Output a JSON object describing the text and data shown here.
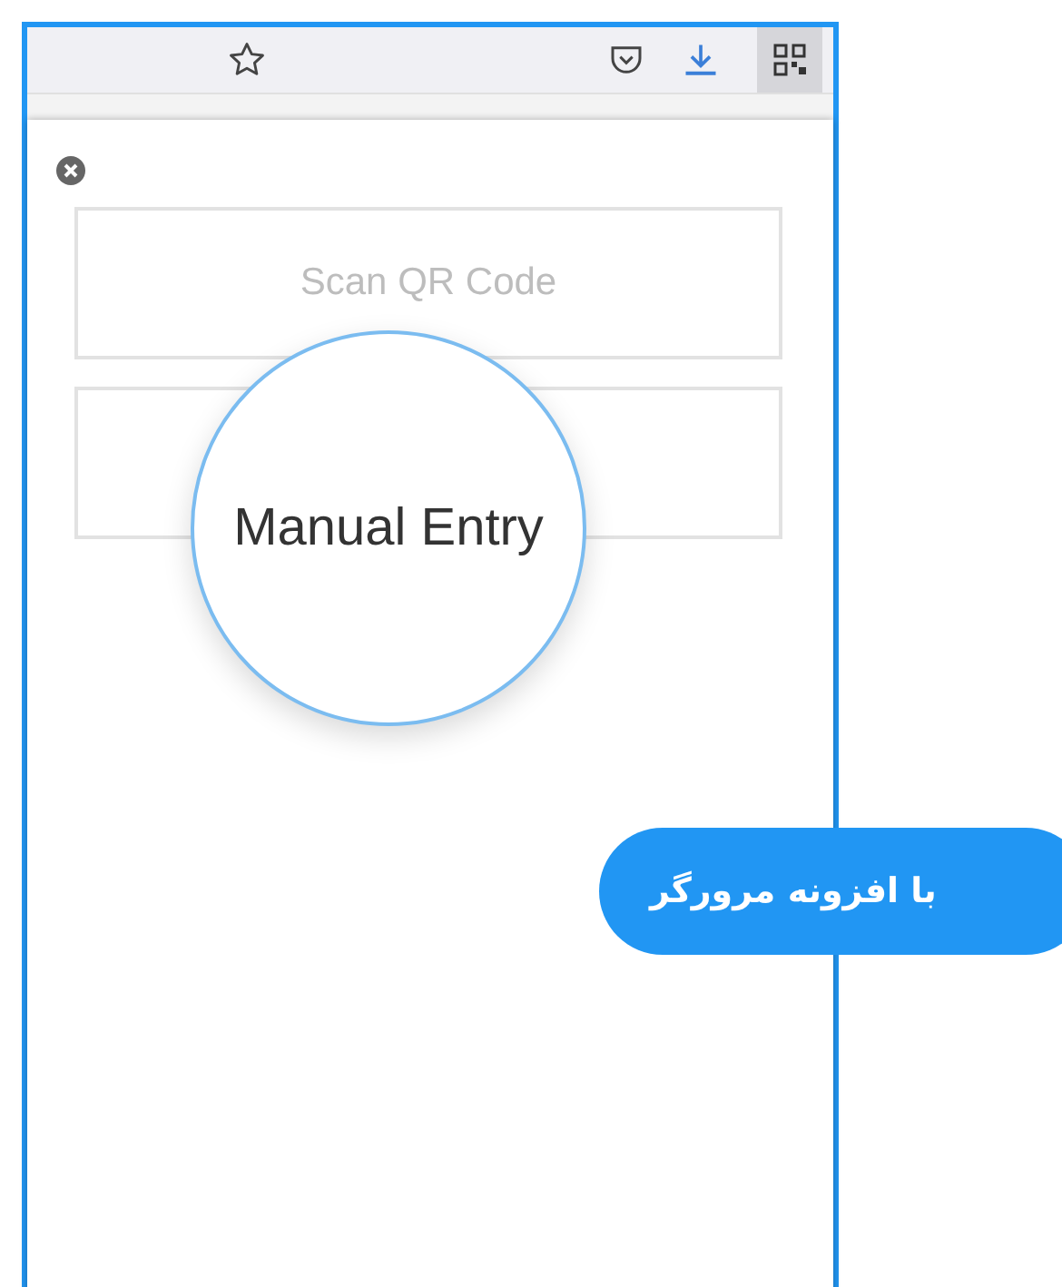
{
  "toolbar": {
    "extension_button": {
      "selected": true
    }
  },
  "popup": {
    "buttons": [
      {
        "label": "Scan QR Code",
        "magnified": false
      },
      {
        "label": "Manual Entry",
        "magnified": true
      }
    ]
  },
  "badge": {
    "text": "با افزونه مرورگر"
  }
}
